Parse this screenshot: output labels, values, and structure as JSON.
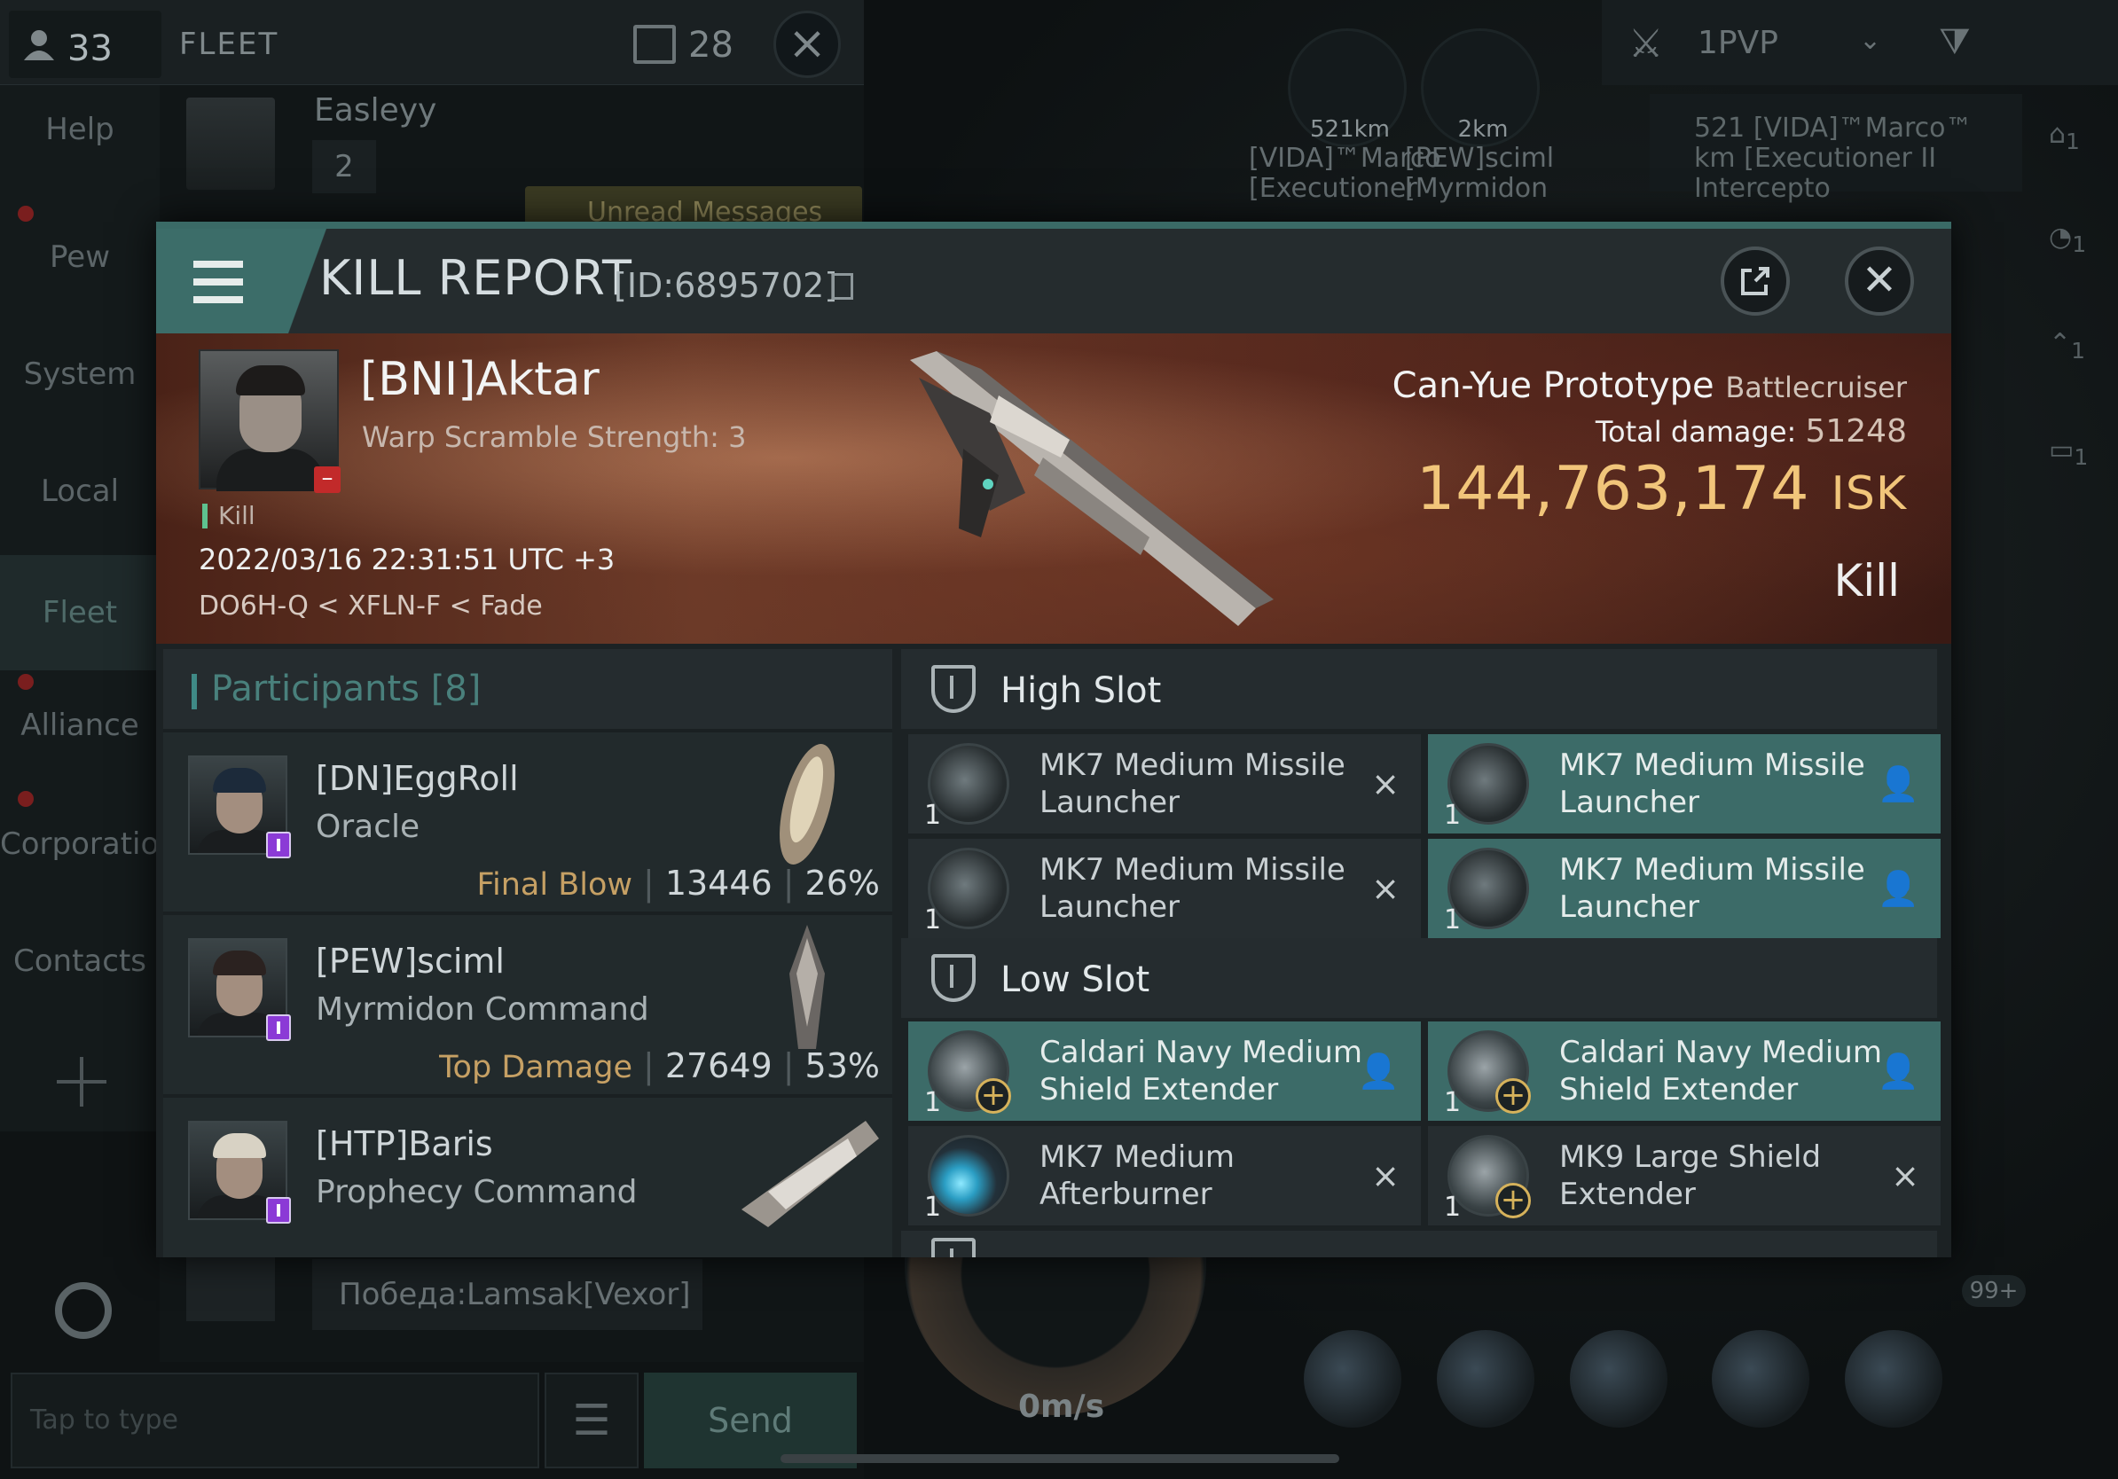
{
  "chat": {
    "people_count": "33",
    "fleet_label": "FLEET",
    "channel_count": "28",
    "nav": [
      "Help",
      "Pew",
      "System",
      "Local",
      "Fleet",
      "Alliance",
      "Corporation",
      "Contacts"
    ],
    "message_name": "Easleyy",
    "message_number": "2",
    "unread_label": "Unread Messages",
    "victory_message": "Победа:Lamsak[Vexor]",
    "input_placeholder": "Tap to type",
    "send_label": "Send"
  },
  "space": {
    "targets": [
      {
        "distance": "521km",
        "name": "[VIDA]™Marco",
        "ship": "[Executioner"
      },
      {
        "distance": "2km",
        "name": "[PEW]sciml",
        "ship": "[Myrmidon"
      }
    ],
    "pvp_label": "1PVP",
    "overview_row": {
      "distance": "521",
      "unit": "km",
      "name": "[VIDA]™Marco™",
      "ship": "[Executioner II Intercepto"
    },
    "side_counts": [
      "1",
      "1",
      "1",
      "1"
    ],
    "speed": "0m/s",
    "badge": "99+"
  },
  "kill_report": {
    "title": "KILL REPORT",
    "id": "[ID:6895702]",
    "victim": {
      "name": "[BNI]Aktar",
      "subtitle": "Warp Scramble Strength: 3",
      "tag": "Kill",
      "datetime": "2022/03/16 22:31:51 UTC +3",
      "location": "DO6H-Q < XFLN-F < Fade"
    },
    "ship": {
      "name": "Can-Yue Prototype",
      "class": "Battlecruiser",
      "total_damage_label": "Total damage:",
      "total_damage": "51248",
      "isk_value": "144,763,174",
      "isk_unit": "ISK",
      "result": "Kill"
    },
    "participants": {
      "label": "Participants",
      "count": "[8]",
      "rows": [
        {
          "name": "[DN]EggRoll",
          "ship": "Oracle",
          "tag": "Final Blow",
          "damage": "13446",
          "percent": "26%"
        },
        {
          "name": "[PEW]sciml",
          "ship": "Myrmidon Command",
          "tag": "Top Damage",
          "damage": "27649",
          "percent": "53%"
        },
        {
          "name": "[HTP]Baris",
          "ship": "Prophecy Command",
          "tag": "",
          "damage": "",
          "percent": ""
        }
      ]
    },
    "high_slot": {
      "label": "High Slot",
      "modules": [
        {
          "line1": "MK7 Medium Missile",
          "line2": "Launcher",
          "qty": "1",
          "status": "×",
          "fit": false
        },
        {
          "line1": "MK7 Medium Missile",
          "line2": "Launcher",
          "qty": "1",
          "status": "👤",
          "fit": true
        },
        {
          "line1": "MK7 Medium Missile",
          "line2": "Launcher",
          "qty": "1",
          "status": "×",
          "fit": false
        },
        {
          "line1": "MK7 Medium Missile",
          "line2": "Launcher",
          "qty": "1",
          "status": "👤",
          "fit": true
        }
      ]
    },
    "low_slot": {
      "label": "Low Slot",
      "modules": [
        {
          "line1": "Caldari Navy Medium",
          "line2": "Shield Extender",
          "qty": "1",
          "status": "👤",
          "fit": true
        },
        {
          "line1": "Caldari Navy Medium",
          "line2": "Shield Extender",
          "qty": "1",
          "status": "👤",
          "fit": true
        },
        {
          "line1": "MK7 Medium",
          "line2": "Afterburner",
          "qty": "1",
          "status": "×",
          "fit": false
        },
        {
          "line1": "MK9 Large Shield",
          "line2": "Extender",
          "qty": "1",
          "status": "×",
          "fit": false
        }
      ]
    }
  }
}
